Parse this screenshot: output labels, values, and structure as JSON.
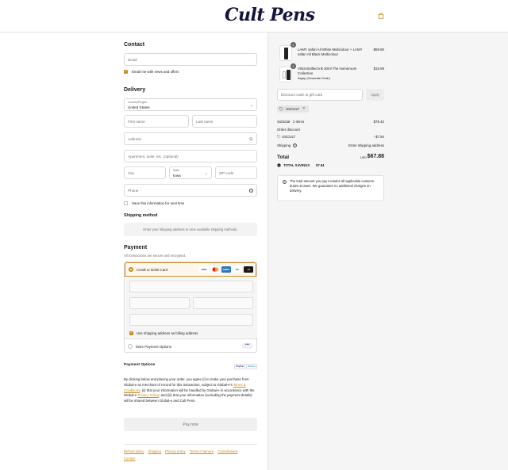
{
  "header": {
    "logo": "Cult Pens"
  },
  "contact": {
    "title": "Contact",
    "email_placeholder": "Email",
    "news_label": "Email me with news and offers"
  },
  "delivery": {
    "title": "Delivery",
    "country_label": "Country/Region",
    "country_value": "United States",
    "first_name": "First name",
    "last_name": "Last name",
    "address": "Address",
    "apartment": "Apartment, suite, etc. (optional)",
    "city": "City",
    "state_label": "State",
    "state_value": "Iowa",
    "zip": "ZIP code",
    "phone": "Phone",
    "save_label": "Save this information for next time"
  },
  "shipping": {
    "title": "Shipping method",
    "message": "Enter your shipping address to view available shipping methods."
  },
  "payment": {
    "title": "Payment",
    "subtitle": "All transactions are secure and encrypted.",
    "card_option": "Credit or Debit Card",
    "cards": [
      "VISA",
      "MC",
      "AMEX",
      "DC",
      "+3"
    ],
    "billing_label": "Use shipping address as billing address",
    "more_option": "More Payment Options",
    "options_title": "Payment Options",
    "paypal": "PayPal",
    "venmo": "Venmo",
    "legal_1": "By clicking below and placing your order, you agree (i) to make your purchase from Global-e as merchant of record for this transaction, subject to Global-e's ",
    "legal_terms": "Terms & Conditions",
    "legal_2": "; (ii) that your information will be handled by Global-e in accordance with the Global-e ",
    "legal_privacy": "Privacy Policy",
    "legal_3": "; and (iii) that your information (excluding the payment details) will be shared between Global-e and Cult Pens.",
    "pay_button": "Pay now"
  },
  "footer": {
    "links": [
      "Refund policy",
      "Shipping",
      "Privacy policy",
      "Terms of service",
      "Cancellations",
      "Contact"
    ]
  },
  "summary": {
    "items": [
      {
        "qty": "1",
        "name": "LAMY safari All White Multicolour + LAMY safari All Black Multicolour",
        "variant": "",
        "price": "$59.80"
      },
      {
        "qty": "1",
        "name": "Vinta Bottled Ink 30ml The Homeroom Collection",
        "variant": "Sagap (Clearwater Drain)",
        "price": "$15.59"
      }
    ],
    "discount_placeholder": "Discount code or gift card",
    "apply_button": "Apply",
    "code_tag": "USCULT",
    "subtotal_label": "Subtotal · 2 items",
    "subtotal_value": "$75.42",
    "order_discount_label": "Order discount",
    "discount_code": "USCULT",
    "discount_value": "- $7.54",
    "shipping_label": "Shipping",
    "shipping_value": "Enter shipping address",
    "total_label": "Total",
    "currency": "USD",
    "total_value": "$67.88",
    "savings_label": "TOTAL SAVINGS",
    "savings_value": "$7.54",
    "notice": "The total amount you pay includes all applicable customs duties & taxes. We guarantee no additional charges on delivery."
  },
  "colors": {
    "accent": "#c98a1b",
    "logo": "#14143c"
  }
}
